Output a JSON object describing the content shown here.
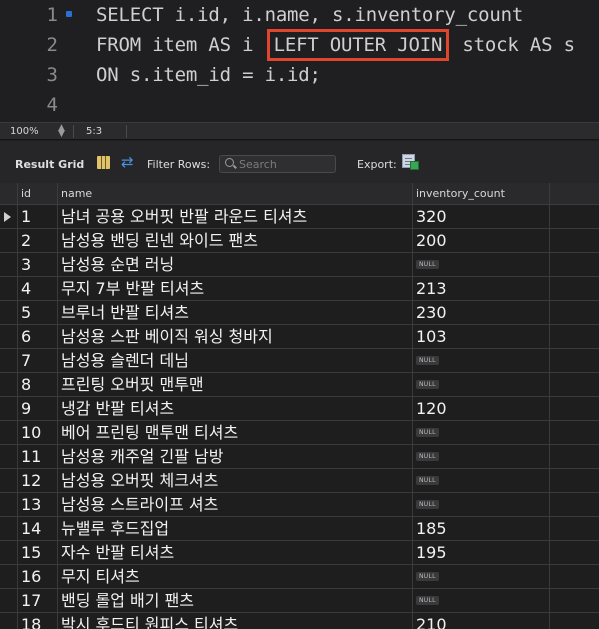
{
  "editor": {
    "lines": [
      {
        "number": "1",
        "text": "SELECT i.id, i.name, s.inventory_count",
        "marker": true
      },
      {
        "number": "2",
        "before": "FROM item AS i ",
        "highlight": "LEFT OUTER JOIN",
        "after": " stock AS s"
      },
      {
        "number": "3",
        "text": "ON s.item_id = i.id;"
      },
      {
        "number": "4",
        "text": ""
      }
    ],
    "highlight_color": "#e0452d"
  },
  "status": {
    "zoom": "100%",
    "cursor": "5:3"
  },
  "toolbar": {
    "result_grid_label": "Result Grid",
    "filter_rows_label": "Filter Rows:",
    "search_placeholder": "Search",
    "export_label": "Export:"
  },
  "grid": {
    "columns": [
      "id",
      "name",
      "inventory_count"
    ],
    "null_label": "NULL",
    "rows": [
      {
        "id": "1",
        "name": "남녀 공용 오버핏 반팔 라운드 티셔츠",
        "inventory_count": "320",
        "selected": true
      },
      {
        "id": "2",
        "name": "남성용 밴딩 린넨 와이드 팬츠",
        "inventory_count": "200"
      },
      {
        "id": "3",
        "name": "남성용 순면 러닝",
        "inventory_count": null
      },
      {
        "id": "4",
        "name": "무지 7부 반팔 티셔츠",
        "inventory_count": "213"
      },
      {
        "id": "5",
        "name": "브루너 반팔 티셔츠",
        "inventory_count": "230"
      },
      {
        "id": "6",
        "name": "남성용 스판 베이직 워싱 청바지",
        "inventory_count": "103"
      },
      {
        "id": "7",
        "name": "남성용 슬렌더 데님",
        "inventory_count": null
      },
      {
        "id": "8",
        "name": "프린팅 오버핏 맨투맨",
        "inventory_count": null
      },
      {
        "id": "9",
        "name": "냉감 반팔 티셔츠",
        "inventory_count": "120"
      },
      {
        "id": "10",
        "name": "베어 프린팅 맨투맨 티셔츠",
        "inventory_count": null
      },
      {
        "id": "11",
        "name": "남성용 캐주얼 긴팔 남방",
        "inventory_count": null
      },
      {
        "id": "12",
        "name": "남성용 오버핏 체크셔츠",
        "inventory_count": null
      },
      {
        "id": "13",
        "name": "남성용 스트라이프 셔츠",
        "inventory_count": null
      },
      {
        "id": "14",
        "name": "뉴밸루 후드집업",
        "inventory_count": "185"
      },
      {
        "id": "15",
        "name": "자수 반팔 티셔츠",
        "inventory_count": "195"
      },
      {
        "id": "16",
        "name": "무지 티셔츠",
        "inventory_count": null
      },
      {
        "id": "17",
        "name": "밴딩 롤업 배기 팬츠",
        "inventory_count": null
      },
      {
        "id": "18",
        "name": "박시 후드티 원피스 티셔츠",
        "inventory_count": "210"
      }
    ]
  }
}
